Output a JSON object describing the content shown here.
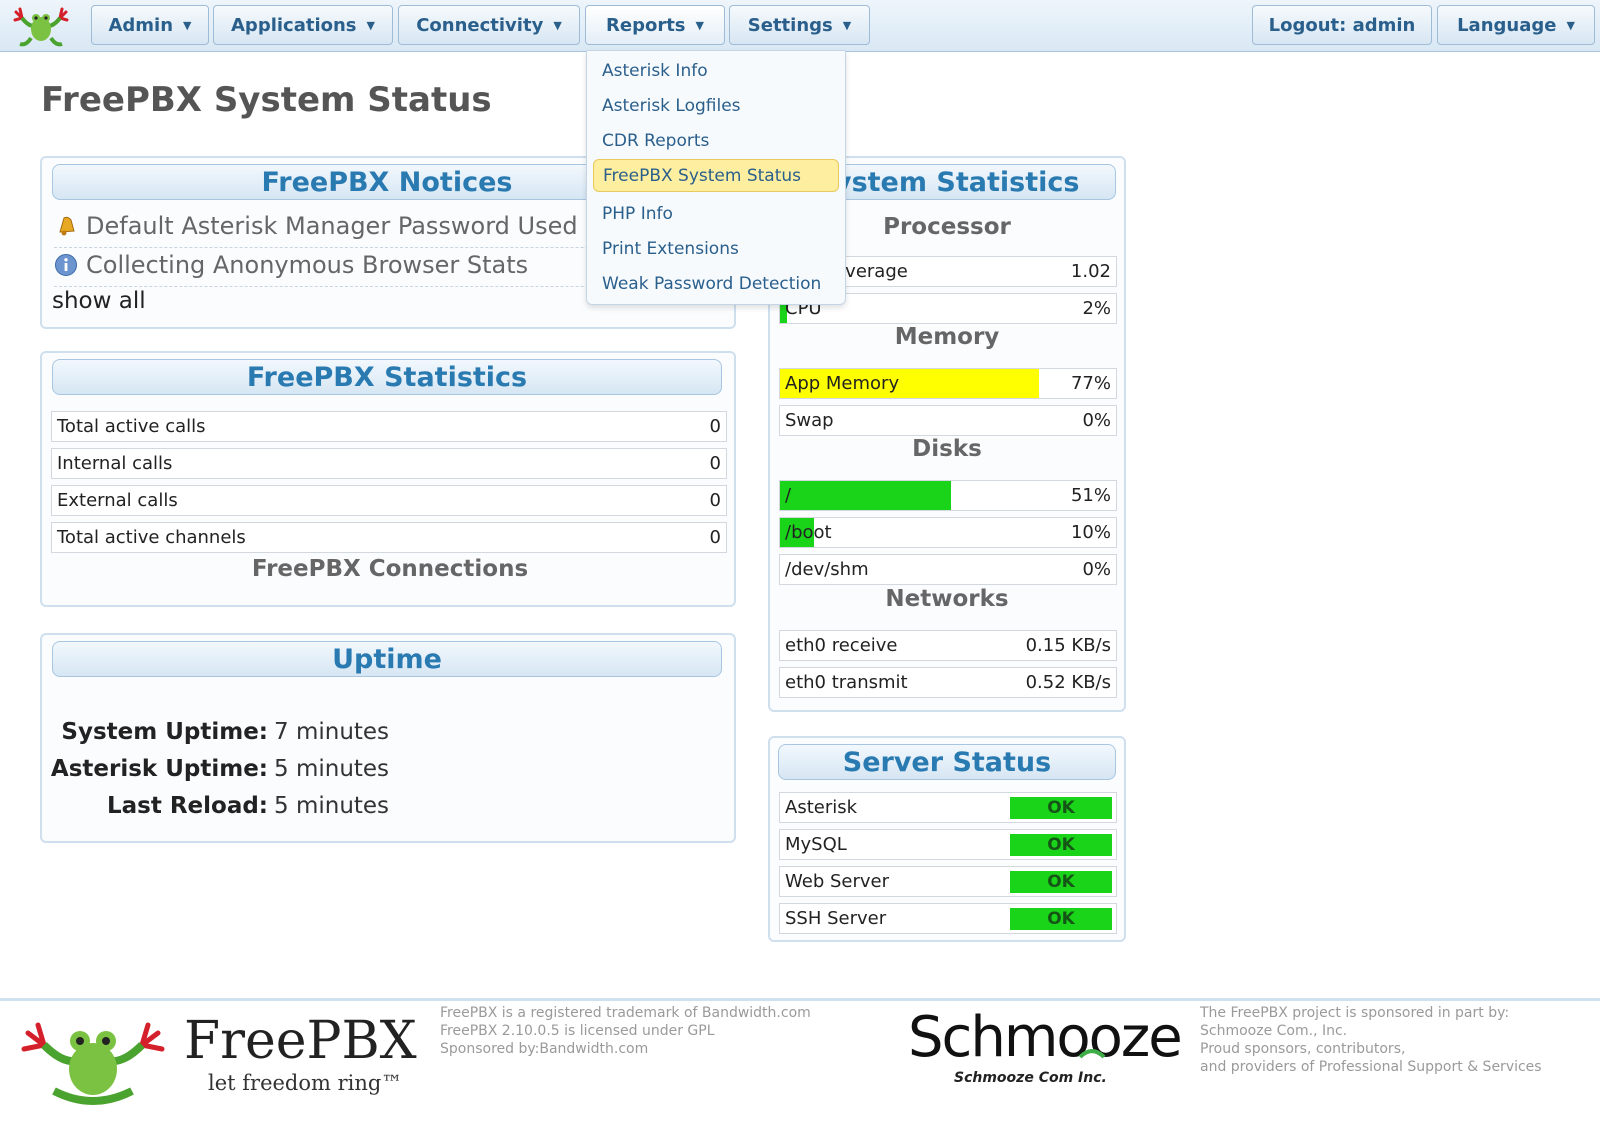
{
  "nav": {
    "menus": [
      {
        "label": "Admin"
      },
      {
        "label": "Applications"
      },
      {
        "label": "Connectivity"
      },
      {
        "label": "Reports"
      },
      {
        "label": "Settings"
      }
    ],
    "logout": "Logout: admin",
    "language": "Language"
  },
  "reports_menu": {
    "items": [
      {
        "label": "Asterisk Info"
      },
      {
        "label": "Asterisk Logfiles"
      },
      {
        "label": "CDR Reports"
      },
      {
        "label": "FreePBX System Status"
      },
      {
        "label": "PHP Info"
      },
      {
        "label": "Print Extensions"
      },
      {
        "label": "Weak Password Detection"
      }
    ],
    "highlighted_index": 3
  },
  "page_title": "FreePBX System Status",
  "notices": {
    "title": "FreePBX Notices",
    "items": [
      {
        "icon": "bell-icon",
        "text": "Default Asterisk Manager Password Used"
      },
      {
        "icon": "info-icon",
        "text": "Collecting Anonymous Browser Stats"
      }
    ],
    "show_all": "show all"
  },
  "freepbx_stats": {
    "title": "FreePBX Statistics",
    "rows": [
      {
        "label": "Total active calls",
        "value": "0"
      },
      {
        "label": "Internal calls",
        "value": "0"
      },
      {
        "label": "External calls",
        "value": "0"
      },
      {
        "label": "Total active channels",
        "value": "0"
      }
    ],
    "connections_title": "FreePBX Connections"
  },
  "uptime": {
    "title": "Uptime",
    "rows": [
      {
        "label": "System Uptime:",
        "value": "7 minutes"
      },
      {
        "label": "Asterisk Uptime:",
        "value": "5 minutes"
      },
      {
        "label": "Last Reload:",
        "value": "5 minutes"
      }
    ]
  },
  "system_stats": {
    "title": "System Statistics",
    "processor": {
      "heading": "Processor",
      "rows": [
        {
          "label": "Load Average",
          "value": "1.02",
          "fill": 0,
          "color": "#1ad41a"
        },
        {
          "label": "CPU",
          "value": "2%",
          "fill": 0.02,
          "color": "#1ad41a"
        }
      ]
    },
    "memory": {
      "heading": "Memory",
      "rows": [
        {
          "label": "App Memory",
          "value": "77%",
          "fill": 0.77,
          "color": "#ffff00"
        },
        {
          "label": "Swap",
          "value": "0%",
          "fill": 0,
          "color": "#1ad41a"
        }
      ]
    },
    "disks": {
      "heading": "Disks",
      "rows": [
        {
          "label": "/",
          "value": "51%",
          "fill": 0.51,
          "color": "#1ad41a"
        },
        {
          "label": "/boot",
          "value": "10%",
          "fill": 0.1,
          "color": "#1ad41a"
        },
        {
          "label": "/dev/shm",
          "value": "0%",
          "fill": 0,
          "color": "#1ad41a"
        }
      ]
    },
    "networks": {
      "heading": "Networks",
      "rows": [
        {
          "label": "eth0 receive",
          "value": "0.15 KB/s"
        },
        {
          "label": "eth0 transmit",
          "value": "0.52 KB/s"
        }
      ]
    }
  },
  "server_status": {
    "title": "Server Status",
    "rows": [
      {
        "label": "Asterisk",
        "status": "OK"
      },
      {
        "label": "MySQL",
        "status": "OK"
      },
      {
        "label": "Web Server",
        "status": "OK"
      },
      {
        "label": "SSH Server",
        "status": "OK"
      }
    ]
  },
  "footer": {
    "freepbx_logo": "FreePBX",
    "freepbx_tagline": "let freedom ring™",
    "legal_lines": [
      "FreePBX is a registered trademark of Bandwidth.com",
      "FreePBX 2.10.0.5 is licensed under GPL",
      "Sponsored by:Bandwidth.com"
    ],
    "schmooze_logo": "Schmooze",
    "schmooze_sub": "Schmooze Com Inc.",
    "sponsor_lines": [
      "The FreePBX project is sponsored in part by:",
      "Schmooze Com., Inc.",
      "Proud sponsors, contributors,",
      "and providers of Professional Support & Services"
    ]
  },
  "colors": {
    "accent": "#2a7ab2",
    "nav_text": "#2a5f8c",
    "ok_green": "#1ad41a",
    "warn_yellow": "#ffff00",
    "menu_highlight": "#fdeea0"
  }
}
